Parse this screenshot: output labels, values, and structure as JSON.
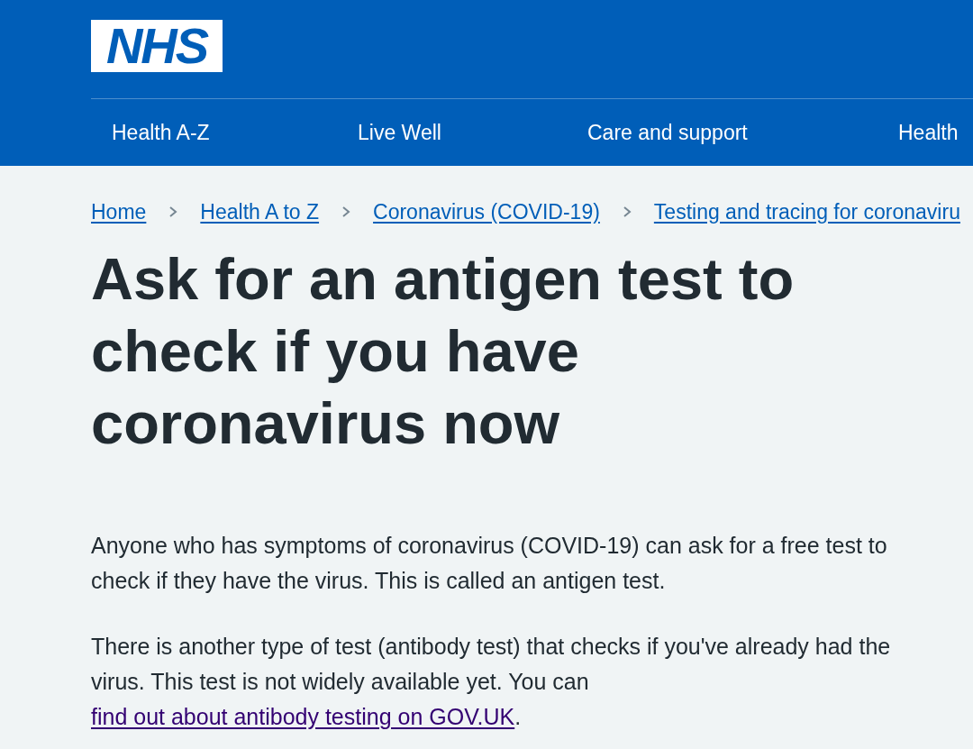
{
  "header": {
    "logo": "NHS",
    "nav": [
      {
        "label": "Health A-Z"
      },
      {
        "label": "Live Well"
      },
      {
        "label": "Care and support"
      },
      {
        "label": "Health"
      }
    ]
  },
  "breadcrumbs": [
    {
      "label": "Home"
    },
    {
      "label": "Health A to Z"
    },
    {
      "label": "Coronavirus (COVID-19)"
    },
    {
      "label": "Testing and tracing for coronaviru"
    }
  ],
  "title": "Ask for an antigen test to check if you have coronavirus now",
  "paragraphs": [
    {
      "text": "Anyone who has symptoms of coronavirus (COVID-19) can ask for a free test to check if they have the virus. This is called an antigen test."
    },
    {
      "text": "There is another type of test (antibody test) that checks if you've already had the virus. This test is not widely available yet. You can",
      "link": "find out about antibody testing on GOV.UK",
      "after": "."
    }
  ]
}
